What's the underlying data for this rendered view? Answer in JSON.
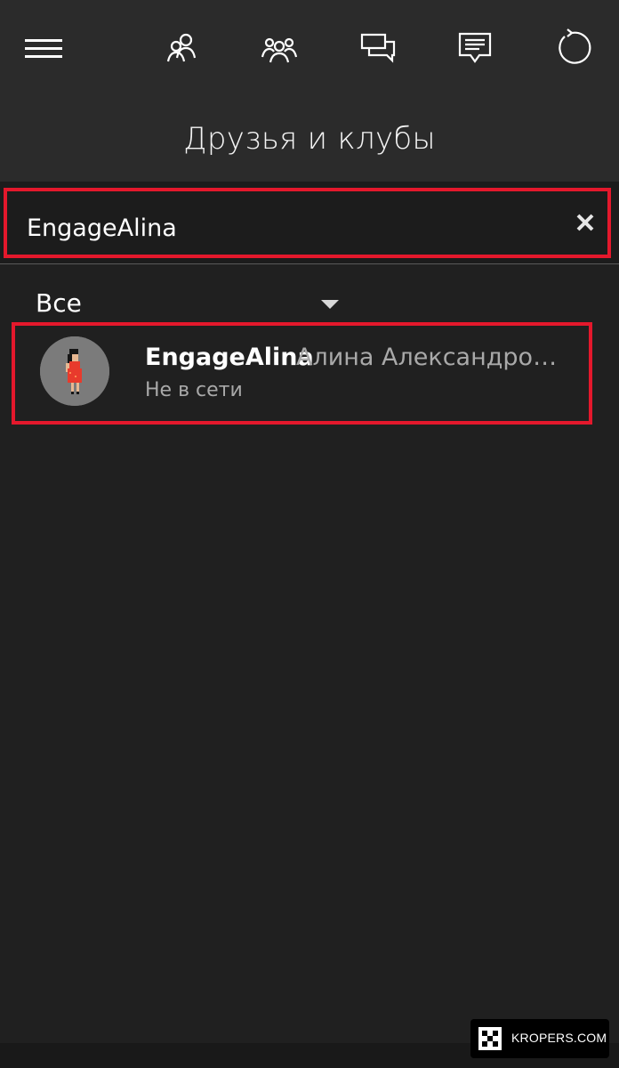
{
  "header": {
    "title": "Друзья и клубы",
    "icons": [
      "menu-icon",
      "friends-icon",
      "party-icon",
      "messages-icon",
      "activity-feed-icon",
      "refresh-icon"
    ]
  },
  "search": {
    "value": "EngageAlina",
    "clear_icon": "close-icon"
  },
  "filter": {
    "label": "Все"
  },
  "results": [
    {
      "gamertag": "EngageAlina",
      "real_name": "Алина Александровс...",
      "status": "Не в сети"
    }
  ],
  "watermark": {
    "text": "KROPERS.COM"
  },
  "colors": {
    "highlight": "#e4182c",
    "header_bg": "#2b2b2b",
    "page_bg": "#202020"
  }
}
